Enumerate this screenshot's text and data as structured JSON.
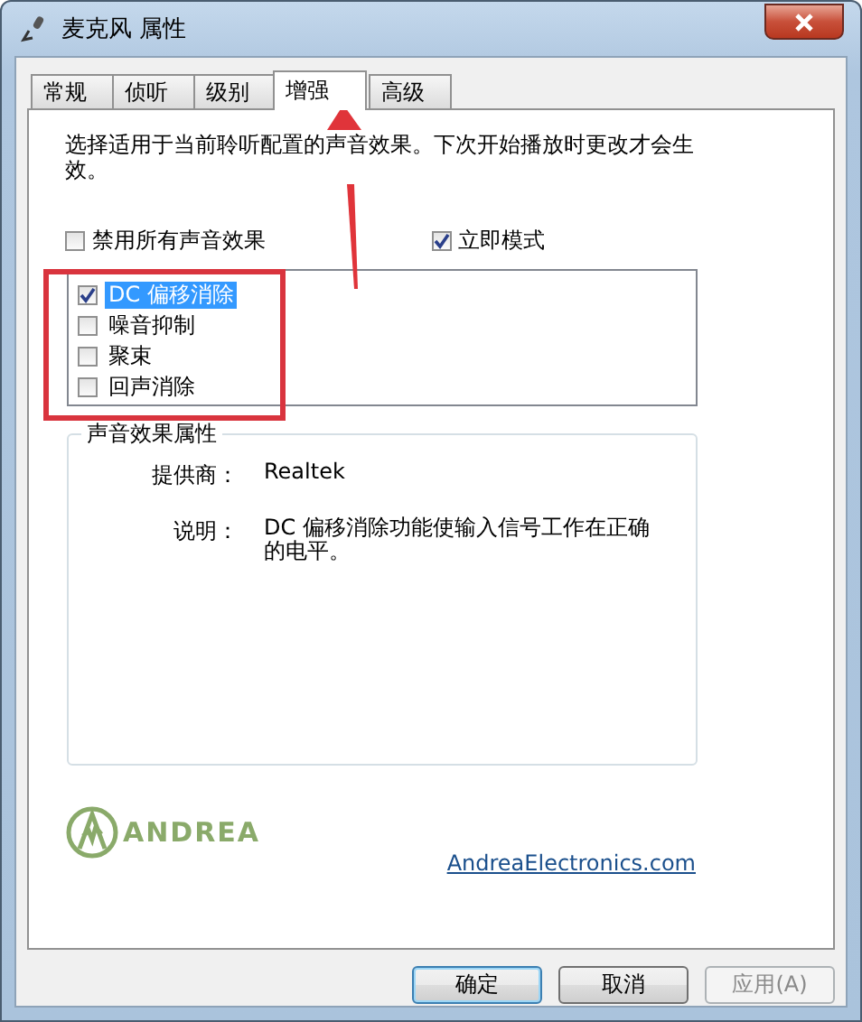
{
  "window": {
    "title": "麦克风 属性"
  },
  "tabs": [
    {
      "label": "常规",
      "selected": false
    },
    {
      "label": "侦听",
      "selected": false
    },
    {
      "label": "级别",
      "selected": false
    },
    {
      "label": "增强",
      "selected": true
    },
    {
      "label": "高级",
      "selected": false
    }
  ],
  "description": "选择适用于当前聆听配置的声音效果。下次开始播放时更改才会生效。",
  "options": [
    {
      "label": "禁用所有声音效果",
      "checked": false
    },
    {
      "label": "立即模式",
      "checked": true
    }
  ],
  "effects": [
    {
      "label": "DC 偏移消除",
      "checked": true,
      "selected": true
    },
    {
      "label": "噪音抑制",
      "checked": false,
      "selected": false
    },
    {
      "label": "聚束",
      "checked": false,
      "selected": false
    },
    {
      "label": "回声消除",
      "checked": false,
      "selected": false
    }
  ],
  "properties": {
    "title": "声音效果属性",
    "fields": [
      {
        "label": "提供商：",
        "value": "Realtek"
      },
      {
        "label": "说明：",
        "value": "DC 偏移消除功能使输入信号工作在正确的电平。"
      }
    ]
  },
  "vendor": {
    "logo_text": "ANDREA",
    "link": "AndreaElectronics.com"
  },
  "buttons": [
    {
      "label": "确定",
      "default": true,
      "disabled": false
    },
    {
      "label": "取消",
      "default": false,
      "disabled": false
    },
    {
      "label": "应用(A)",
      "default": false,
      "disabled": true
    }
  ]
}
